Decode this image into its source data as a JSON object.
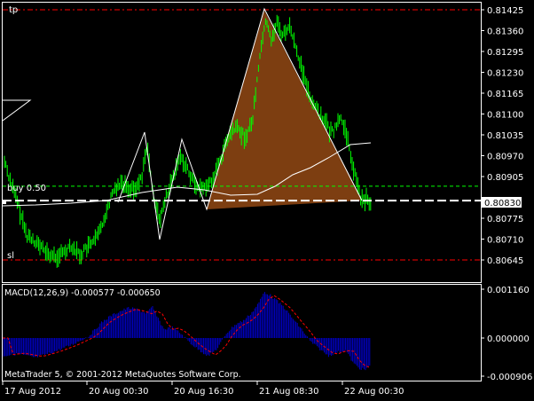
{
  "app": {
    "copyright": "MetaTrader 5, © 2001-2012 MetaQuotes Software Corp."
  },
  "price_chart": {
    "labels": {
      "tp": "tp",
      "buy": "buy 0.50",
      "sl": "sl"
    },
    "price_axis": [
      "0.81425",
      "0.81360",
      "0.81295",
      "0.81230",
      "0.81165",
      "0.81100",
      "0.81035",
      "0.80970",
      "0.80905",
      "0.80830",
      "0.80775",
      "0.80710",
      "0.80645"
    ],
    "current_price": "0.80830",
    "colors": {
      "bars": "#00ff00",
      "zigzag": "#ffffff",
      "moving_average": "#ffffff",
      "pattern_fill": "#8b4513",
      "tp_line": "#ff0000",
      "buy_line": "#00ff00",
      "sl_line": "#ff0000",
      "bid_line": "#ffffff"
    },
    "levels": {
      "tp": 0.81425,
      "buy": 0.80875,
      "sl": 0.80645,
      "bid": 0.8083
    }
  },
  "macd_panel": {
    "title": "MACD(12,26,9) -0.000577 -0.000650",
    "axis": [
      "0.001160",
      "0.000000",
      "-0.000906"
    ],
    "colors": {
      "histogram": "#0000cd",
      "signal": "#ff0000"
    }
  },
  "time_axis": [
    "17 Aug 2012",
    "20 Aug 00:30",
    "20 Aug 16:30",
    "21 Aug 08:30",
    "22 Aug 00:30"
  ]
}
